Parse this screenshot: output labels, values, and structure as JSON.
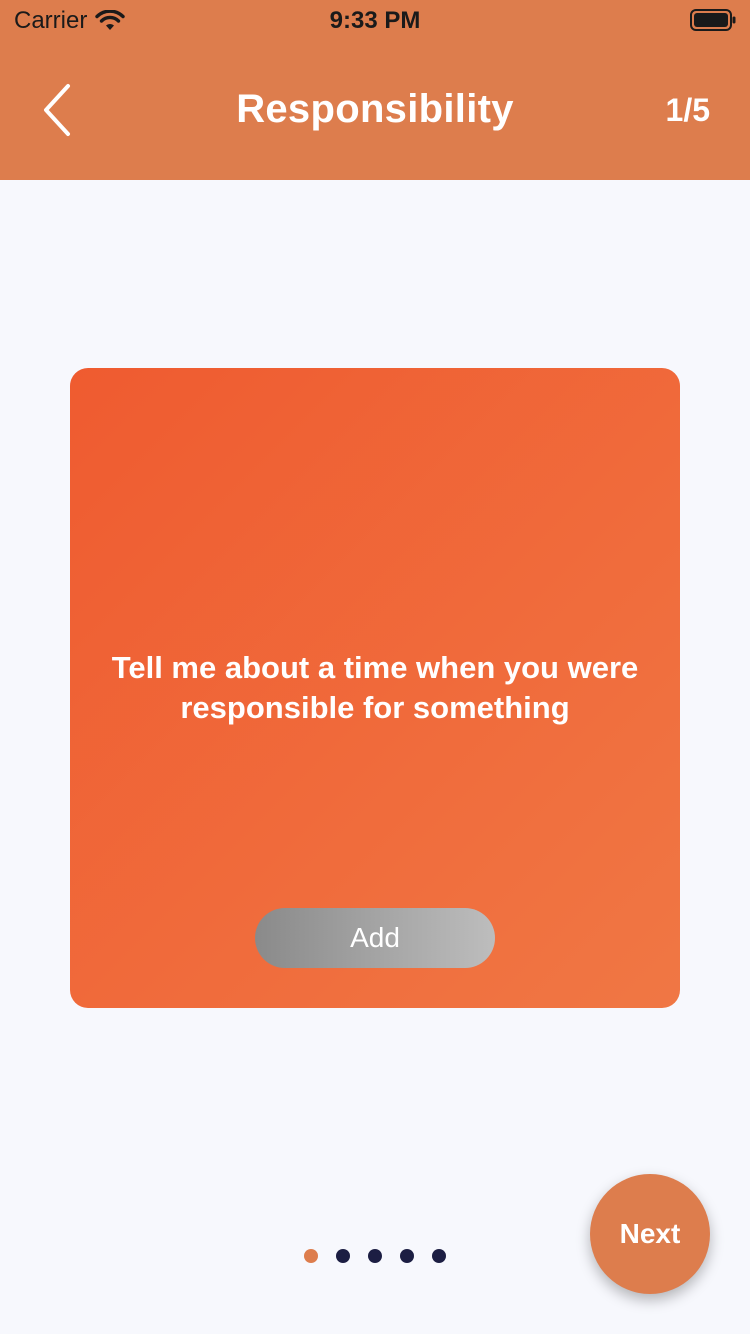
{
  "status_bar": {
    "carrier": "Carrier",
    "time": "9:33 PM",
    "wifi_icon": "wifi-icon",
    "battery_icon": "battery-icon"
  },
  "nav": {
    "back_icon": "chevron-left-icon",
    "title": "Responsibility",
    "counter": "1/5"
  },
  "card": {
    "question": "Tell me about a time when you were responsible for something",
    "add_label": "Add"
  },
  "pagination": {
    "total": 5,
    "active_index": 0
  },
  "next_label": "Next",
  "colors": {
    "accent": "#DD7D4D",
    "card_start": "#EF5B30",
    "card_end": "#F07744",
    "dot_inactive": "#1C1E43",
    "background": "#F7F8FD"
  }
}
